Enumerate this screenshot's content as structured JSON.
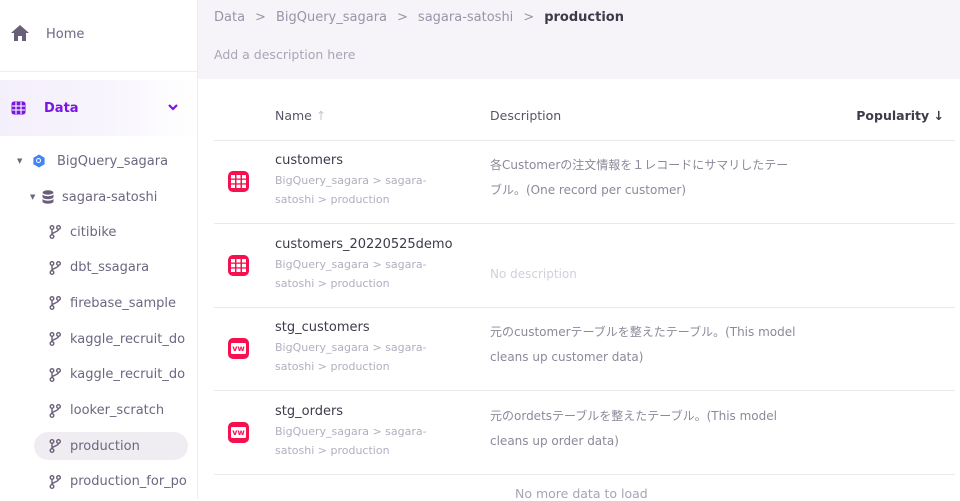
{
  "sidebar": {
    "home": "Home",
    "data": "Data",
    "tree": [
      {
        "label": "BigQuery_sagara",
        "icon": "bigquery-icon"
      },
      {
        "label": "sagara-satoshi",
        "icon": "database-icon"
      },
      {
        "label": "citibike",
        "icon": "branch-icon"
      },
      {
        "label": "dbt_ssagara",
        "icon": "branch-icon"
      },
      {
        "label": "firebase_sample",
        "icon": "branch-icon"
      },
      {
        "label": "kaggle_recruit_do",
        "icon": "branch-icon"
      },
      {
        "label": "kaggle_recruit_do",
        "icon": "branch-icon"
      },
      {
        "label": "looker_scratch",
        "icon": "branch-icon"
      },
      {
        "label": "production",
        "icon": "branch-icon",
        "selected": true
      },
      {
        "label": "production_for_po",
        "icon": "branch-icon"
      }
    ]
  },
  "breadcrumb": [
    "Data",
    "BigQuery_sagara",
    "sagara-satoshi",
    "production"
  ],
  "breadcrumb_sep": ">",
  "description_placeholder": "Add a description here",
  "table": {
    "headers": {
      "name": "Name",
      "name_sort": "↑",
      "description": "Description",
      "popularity": "Popularity",
      "popularity_sort": "↓"
    },
    "rows": [
      {
        "name": "customers",
        "path1": "BigQuery_sagara > sagara-",
        "path2": "satoshi > production",
        "type": "table",
        "desc1": "各Customerの注文情報を１レコードにサマリしたテー",
        "desc2": "ブル。(One record per customer)"
      },
      {
        "name": "customers_20220525demo",
        "path1": "BigQuery_sagara > sagara-",
        "path2": "satoshi > production",
        "type": "table",
        "desc1": "No description",
        "desc2": ""
      },
      {
        "name": "stg_customers",
        "path1": "BigQuery_sagara > sagara-",
        "path2": "satoshi > production",
        "type": "view",
        "desc1": "元のcustomerテーブルを整えたテーブル。(This model",
        "desc2": "cleans up customer data)"
      },
      {
        "name": "stg_orders",
        "path1": "BigQuery_sagara > sagara-",
        "path2": "satoshi > production",
        "type": "view",
        "desc1": "元のordetsテーブルを整えたテーブル。(This model",
        "desc2": "cleans up order data)"
      }
    ],
    "view_badge": "vw",
    "footer": "No more data to load"
  },
  "colors": {
    "accent": "#7a14e0",
    "table_icon": "#f5104f"
  }
}
